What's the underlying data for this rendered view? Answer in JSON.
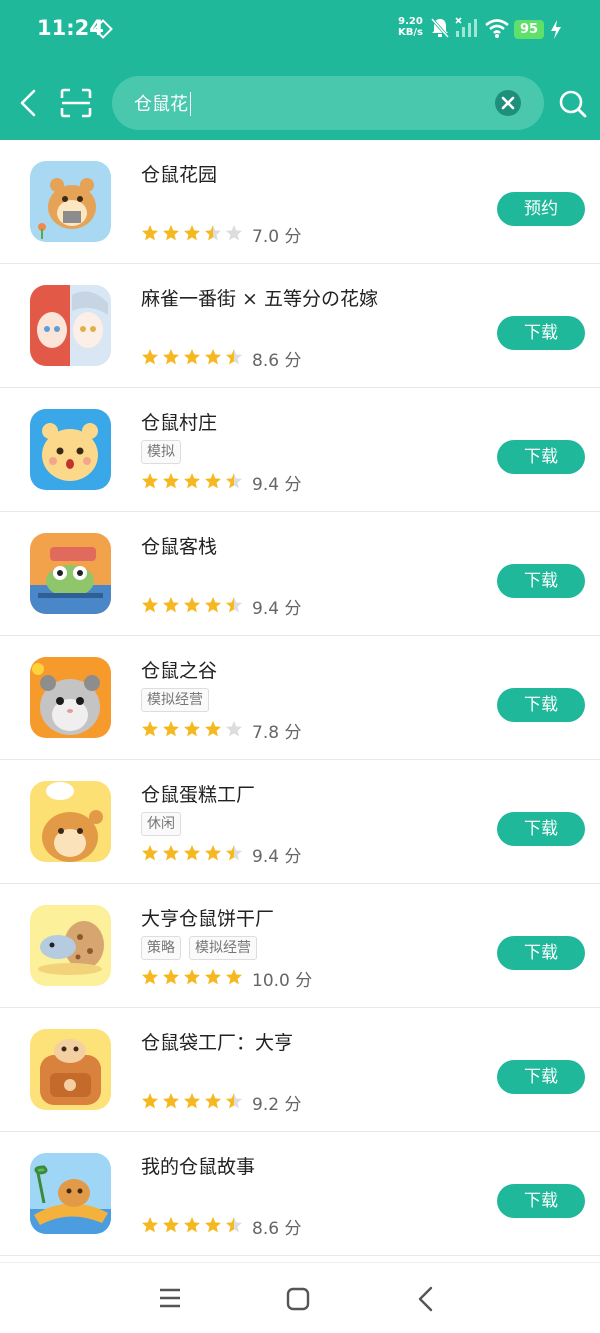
{
  "status": {
    "time": "11:24",
    "net_speed_value": "9.20",
    "net_speed_unit": "KB/s",
    "battery": "95"
  },
  "search": {
    "value": "仓鼠花"
  },
  "apps": [
    {
      "name": "仓鼠花园",
      "tags": [],
      "rating": 3.5,
      "score": "7.0 分",
      "action": "预约"
    },
    {
      "name": "麻雀一番街 × 五等分の花嫁",
      "tags": [],
      "rating": 4.5,
      "score": "8.6 分",
      "action": "下载"
    },
    {
      "name": "仓鼠村庄",
      "tags": [
        "模拟"
      ],
      "rating": 4.5,
      "score": "9.4 分",
      "action": "下载"
    },
    {
      "name": "仓鼠客栈",
      "tags": [],
      "rating": 4.5,
      "score": "9.4 分",
      "action": "下载"
    },
    {
      "name": "仓鼠之谷",
      "tags": [
        "模拟经营"
      ],
      "rating": 4,
      "score": "7.8 分",
      "action": "下载"
    },
    {
      "name": "仓鼠蛋糕工厂",
      "tags": [
        "休闲"
      ],
      "rating": 4.5,
      "score": "9.4 分",
      "action": "下载"
    },
    {
      "name": "大亨仓鼠饼干厂",
      "tags": [
        "策略",
        "模拟经营"
      ],
      "rating": 5,
      "score": "10.0 分",
      "action": "下载"
    },
    {
      "name": "仓鼠袋工厂：大亨",
      "tags": [],
      "rating": 4.5,
      "score": "9.2 分",
      "action": "下载"
    },
    {
      "name": "我的仓鼠故事",
      "tags": [],
      "rating": 4.5,
      "score": "8.6 分",
      "action": "下载"
    }
  ],
  "icons": {
    "back": "back-arrow-icon",
    "scan": "scan-icon",
    "clear": "clear-icon",
    "search": "search-icon",
    "nav_menu": "menu-icon",
    "nav_home": "home-icon",
    "nav_back": "back-icon"
  },
  "colors": {
    "accent": "#1fb89a",
    "star": "#f5b820",
    "star_empty": "#dddddd",
    "battery": "#5fe06b"
  }
}
